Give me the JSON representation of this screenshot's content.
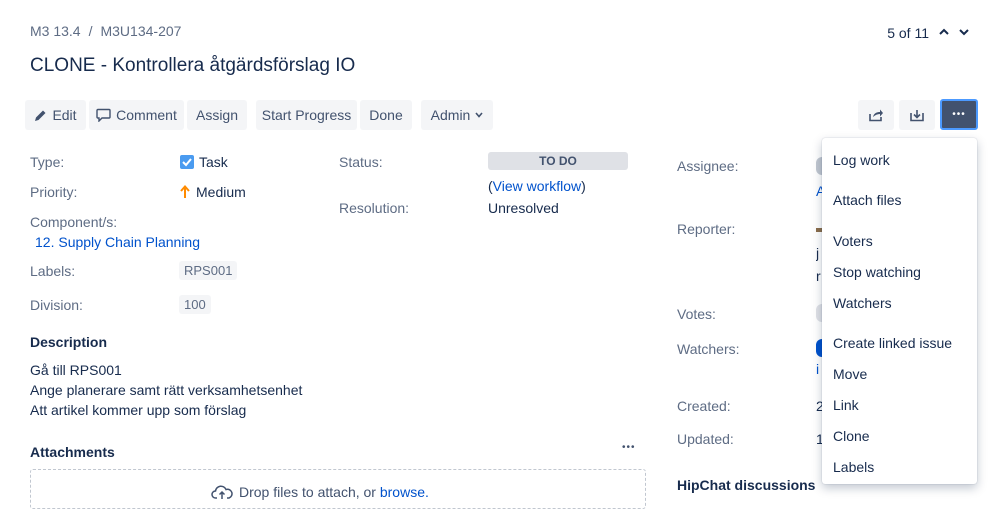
{
  "breadcrumb": {
    "project": "M3 13.4",
    "separator": "/",
    "issue_key": "M3U134-207"
  },
  "pager": {
    "text": "5 of 11"
  },
  "title": "CLONE - Kontrollera åtgärdsförslag IO",
  "toolbar": {
    "edit": "Edit",
    "comment": "Comment",
    "assign": "Assign",
    "start_progress": "Start Progress",
    "done": "Done",
    "admin": "Admin",
    "more": "•••"
  },
  "details": {
    "type_label": "Type:",
    "type_value": "Task",
    "priority_label": "Priority:",
    "priority_value": "Medium",
    "component_label": "Component/s:",
    "component_value": "12. Supply Chain Planning",
    "labels_label": "Labels:",
    "labels_value": "RPS001",
    "division_label": "Division:",
    "division_value": "100",
    "status_label": "Status:",
    "status_value": "TO DO",
    "workflow_open": "(",
    "workflow_link": "View workflow",
    "workflow_close": ")",
    "resolution_label": "Resolution:",
    "resolution_value": "Unresolved"
  },
  "people": {
    "assignee_label": "Assignee:",
    "reporter_label": "Reporter:",
    "votes_label": "Votes:",
    "watchers_label": "Watchers:"
  },
  "dates": {
    "created_label": "Created:",
    "updated_label": "Updated:"
  },
  "hipchat": "HipChat discussions",
  "description": {
    "heading": "Description",
    "lines": [
      "Gå till RPS001",
      "Ange planerare samt rätt verksamhetsenhet",
      "Att artikel kommer upp som förslag"
    ]
  },
  "attachments": {
    "heading": "Attachments",
    "more": "•••",
    "drop_text": "Drop files to attach, or ",
    "browse": "browse."
  },
  "menu": {
    "items": [
      "Log work",
      "Attach files",
      "Voters",
      "Stop watching",
      "Watchers",
      "Create linked issue",
      "Move",
      "Link",
      "Clone",
      "Labels"
    ]
  },
  "colors": {
    "accent": "#0052cc",
    "dark_button": "#42526e",
    "priority_arrow": "#ff8b00",
    "checkbox": "#4a9bf0"
  }
}
